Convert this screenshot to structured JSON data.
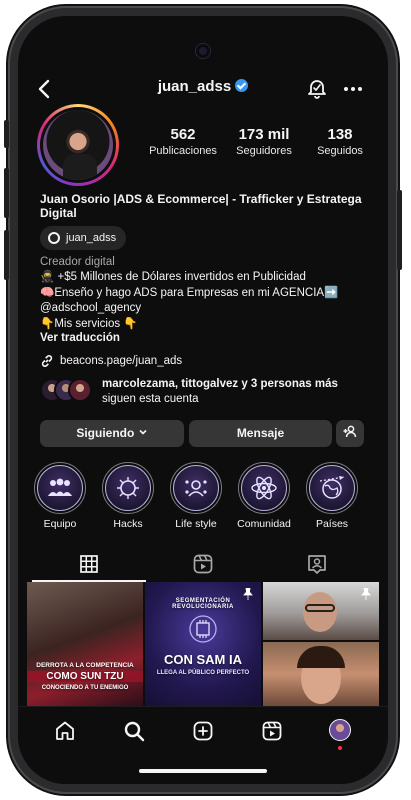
{
  "header": {
    "username": "juan_adss",
    "back_icon": "chevron-left-icon",
    "notification_icon": "bell-icon",
    "more_icon": "more-horizontal-icon",
    "verified": true
  },
  "profile": {
    "stats": [
      {
        "value": "562",
        "label": "Publicaciones"
      },
      {
        "value": "173 mil",
        "label": "Seguidores"
      },
      {
        "value": "138",
        "label": "Seguidos"
      }
    ],
    "full_name": "Juan Osorio |ADS & Ecommerce| - Trafficker y Estratega Digital",
    "threads_handle": "juan_adss",
    "category": "Creador digital",
    "bio_lines": [
      "🥷 +$5 Millones de Dólares invertidos en Publicidad",
      "🧠Enseño y hago ADS para Empresas en mi AGENCIA➡️",
      "@adschool_agency",
      "👇Mis servicios 👇"
    ],
    "see_translation": "Ver traducción",
    "link": "beacons.page/juan_ads",
    "followed_by_names": "marcolezama, tittogalvez",
    "followed_by_rest": " y 3 personas más",
    "followed_by_suffix": "siguen esta cuenta"
  },
  "actions": {
    "following_label": "Siguiendo",
    "message_label": "Mensaje",
    "add_person_icon": "add-person-icon"
  },
  "highlights": [
    {
      "label": "Equipo"
    },
    {
      "label": "Hacks"
    },
    {
      "label": "Life style"
    },
    {
      "label": "Comunidad"
    },
    {
      "label": "Países"
    }
  ],
  "tabs": [
    {
      "icon": "grid-icon",
      "active": true
    },
    {
      "icon": "reels-icon",
      "active": false
    },
    {
      "icon": "tagged-icon",
      "active": false
    }
  ],
  "posts": [
    {
      "caption_top": "DERROTA A LA COMPETENCIA",
      "caption_main": "COMO SUN TZU",
      "caption_sub": "CONOCIENDO A TU ENEMIGO"
    },
    {
      "caption_top": "SEGMENTACIÓN REVOLUCIONARIA",
      "caption_main": "CON SAM IA",
      "caption_sub": "LLEGA AL PÚBLICO PERFECTO",
      "pinned": true
    },
    {
      "caption_top": "",
      "caption_main": "",
      "caption_sub": "",
      "pinned": true
    },
    {
      "caption_top": "",
      "caption_main": "",
      "caption_sub": ""
    }
  ],
  "bottom_nav": [
    {
      "icon": "home-icon"
    },
    {
      "icon": "search-icon"
    },
    {
      "icon": "create-icon"
    },
    {
      "icon": "reels-icon"
    },
    {
      "icon": "profile-avatar-icon"
    }
  ],
  "colors": {
    "background": "#0d0d0d",
    "button": "#363636",
    "verified_blue": "#3897f0",
    "secondary_text": "#a8a8a8"
  }
}
